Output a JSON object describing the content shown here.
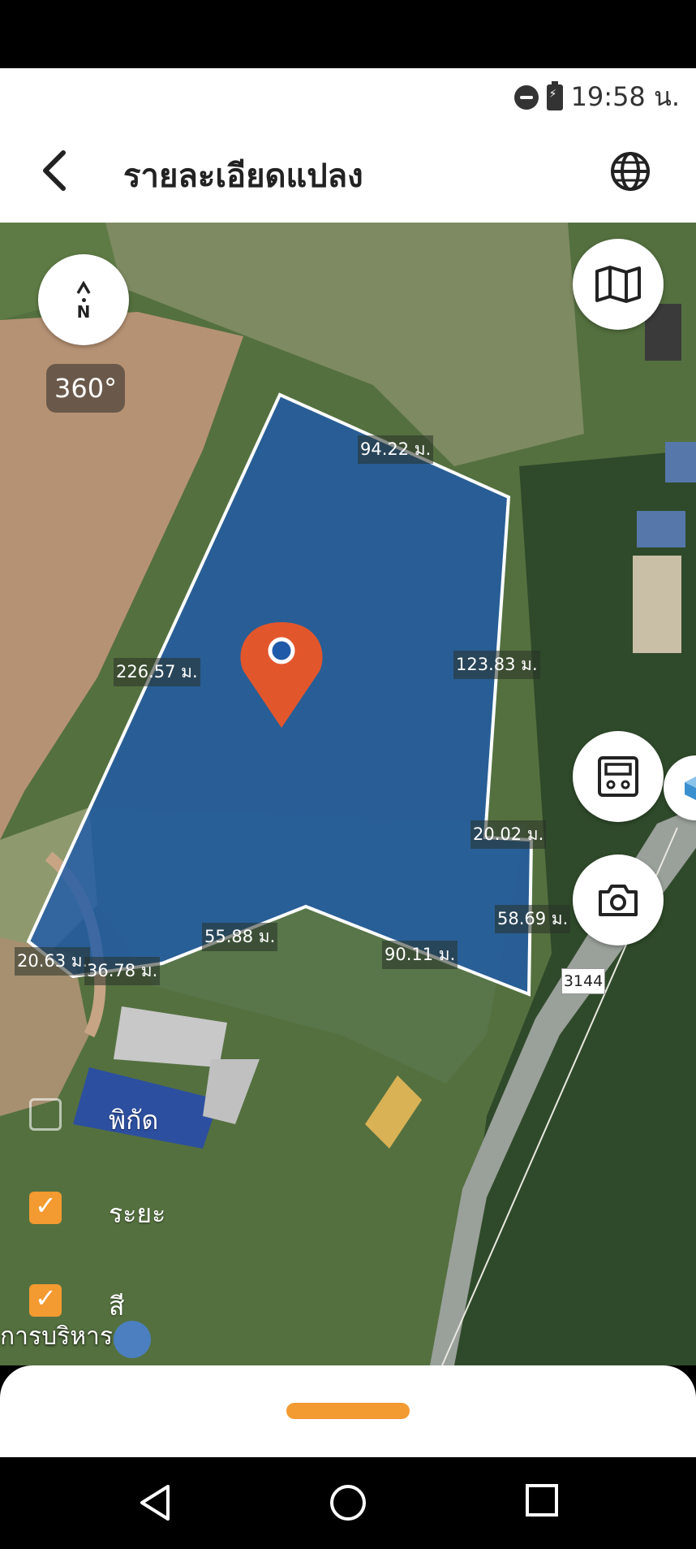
{
  "status": {
    "time": "19:58 น."
  },
  "appbar": {
    "title": "รายละเอียดแปลง"
  },
  "map": {
    "compass_label": "N",
    "rotation_label": "360°",
    "road_number": "3144",
    "place_label": "การบริหาร",
    "dimensions": [
      "94.22 ม.",
      "226.57 ม.",
      "123.83 ม.",
      "20.02 ม.",
      "58.69 ม.",
      "55.88 ม.",
      "90.11 ม.",
      "20.63 ม.",
      "36.78 ม."
    ],
    "layers": [
      {
        "label": "พิกัด",
        "checked": false
      },
      {
        "label": "ระยะ",
        "checked": true
      },
      {
        "label": "สี",
        "checked": true
      }
    ],
    "polygon_color": "#1f5aa8",
    "pin_color": "#e2562c"
  }
}
